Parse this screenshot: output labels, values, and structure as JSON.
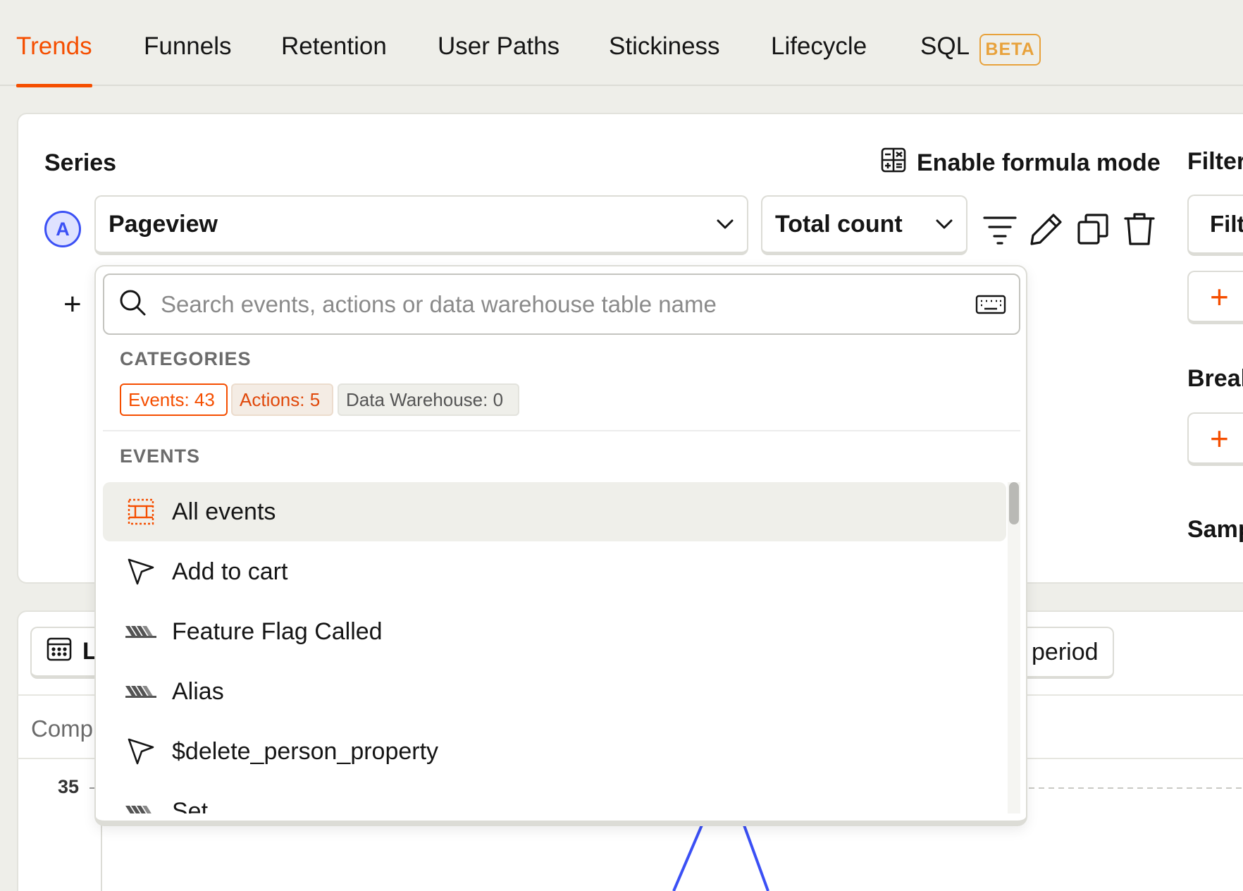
{
  "tabs": [
    {
      "label": "Trends",
      "active": true
    },
    {
      "label": "Funnels"
    },
    {
      "label": "Retention"
    },
    {
      "label": "User Paths"
    },
    {
      "label": "Stickiness"
    },
    {
      "label": "Lifecycle"
    },
    {
      "label": "SQL"
    }
  ],
  "sql_badge": "BETA",
  "series": {
    "title": "Series",
    "formula_mode_label": "Enable formula mode",
    "letter": "A",
    "event_value": "Pageview",
    "math_value": "Total count",
    "icons": [
      "filter-icon",
      "pencil-icon",
      "duplicate-icon",
      "trash-icon"
    ],
    "add_label": "+"
  },
  "right_panel": {
    "filters_title": "Filter",
    "filter_input_text": "Filte",
    "breakdown_title": "Breal",
    "sampling_title": "Samp",
    "plus": "+"
  },
  "popover": {
    "search_placeholder": "Search events, actions or data warehouse table name",
    "categories_label": "CATEGORIES",
    "chips": {
      "events": "Events: 43",
      "actions": "Actions: 5",
      "warehouse": "Data Warehouse: 0"
    },
    "events_label": "EVENTS",
    "events": [
      {
        "label": "All events",
        "icon": "all-events-icon",
        "selected": true
      },
      {
        "label": "Add to cart",
        "icon": "cursor-icon"
      },
      {
        "label": "Feature Flag Called",
        "icon": "autocapture-icon"
      },
      {
        "label": "Alias",
        "icon": "autocapture-icon"
      },
      {
        "label": "$delete_person_property",
        "icon": "cursor-icon"
      },
      {
        "label": "Set",
        "icon": "autocapture-icon"
      }
    ]
  },
  "chart_toolbar": {
    "date_label": "L",
    "period_label": "period",
    "compare_label": "Comp"
  },
  "chart": {
    "y_tick": "35",
    "line_color": "#3b50f5"
  },
  "colors": {
    "accent": "#f54e00",
    "series_blue": "#3b50f5",
    "beta": "#e8a23c"
  }
}
